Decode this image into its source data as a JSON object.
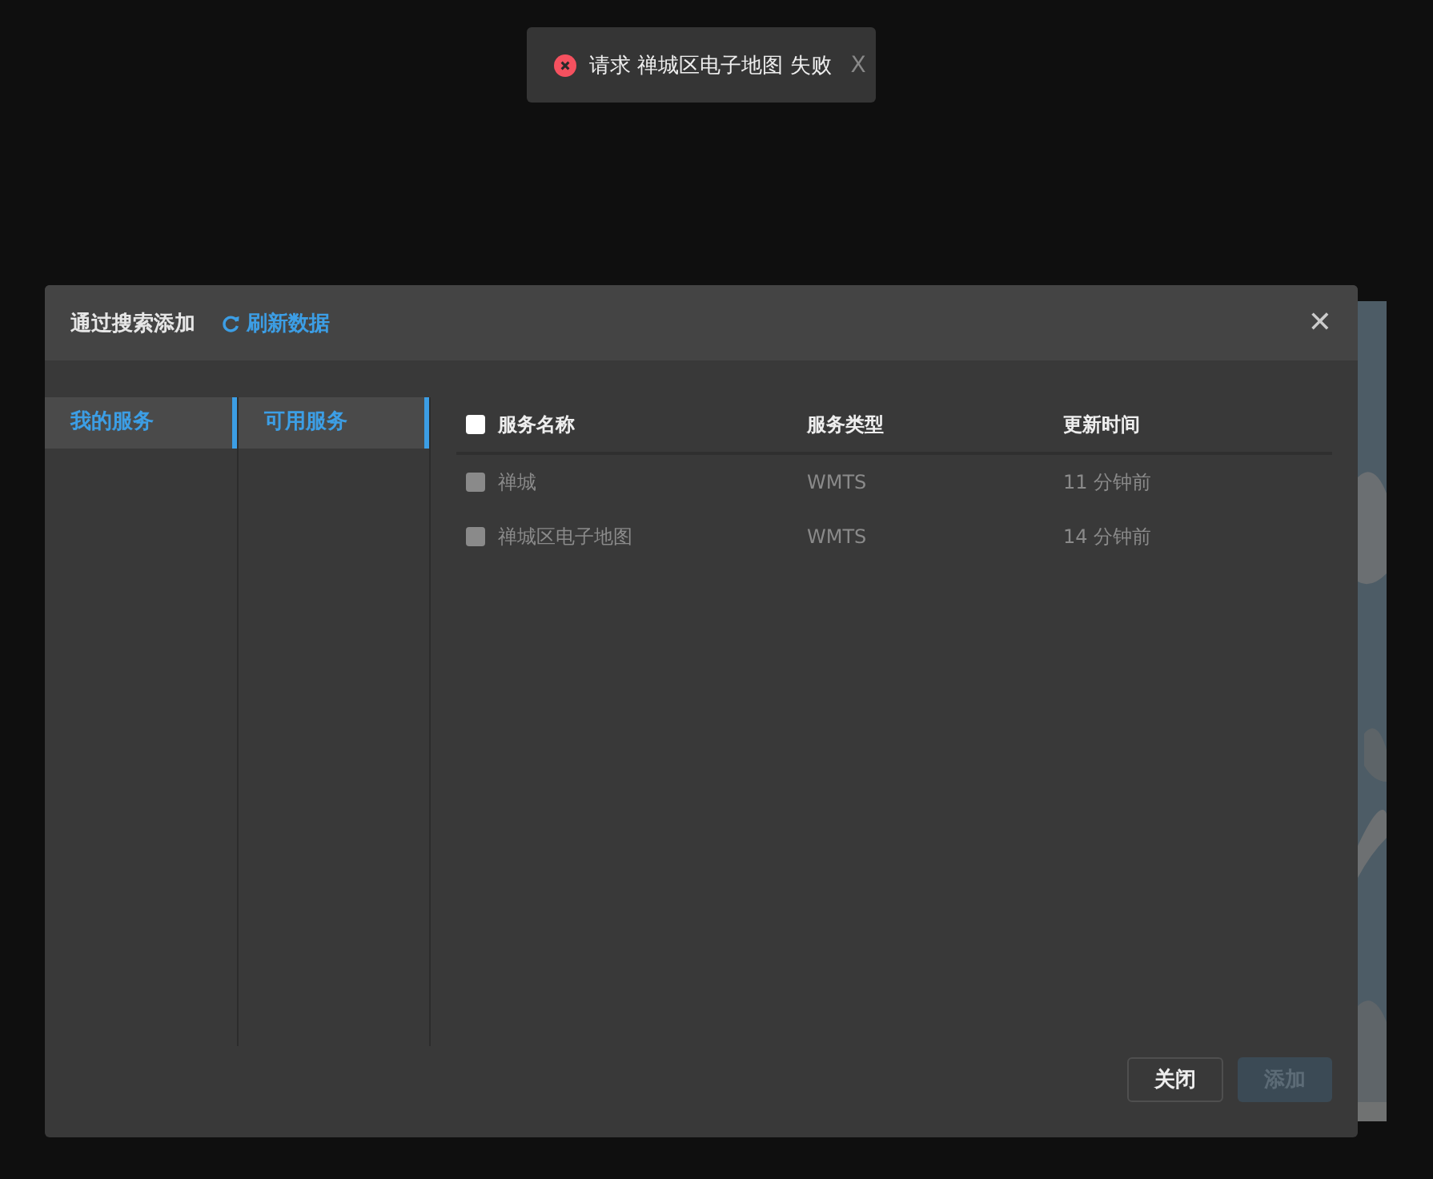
{
  "toast": {
    "kind": "error",
    "message": "请求 禅城区电子地图 失败",
    "close": "X"
  },
  "dialog": {
    "title": "通过搜索添加",
    "refresh": "刷新数据",
    "close": "✕"
  },
  "menu_columns": [
    {
      "items": [
        {
          "label": "我的服务",
          "selected": true
        }
      ]
    },
    {
      "items": [
        {
          "label": "可用服务",
          "selected": true
        }
      ]
    }
  ],
  "table": {
    "select_all": {
      "checked": false,
      "disabled": false
    },
    "columns": [
      "服务名称",
      "服务类型",
      "更新时间"
    ],
    "rows": [
      {
        "checked": false,
        "disabled": true,
        "cells": [
          "禅城",
          "WMTS",
          "11 分钟前"
        ]
      },
      {
        "checked": false,
        "disabled": true,
        "cells": [
          "禅城区电子地图",
          "WMTS",
          "14 分钟前"
        ]
      }
    ]
  },
  "buttons": [
    {
      "label": "关闭",
      "disabled": false
    },
    {
      "label": "添加",
      "disabled": true
    }
  ]
}
